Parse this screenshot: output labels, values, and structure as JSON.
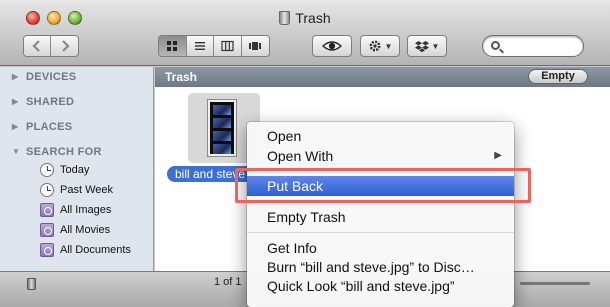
{
  "window": {
    "title": "Trash"
  },
  "toolbar": {
    "back_icon": "chevron-left-icon",
    "forward_icon": "chevron-right-icon",
    "view_modes": [
      "icon-view",
      "list-view",
      "column-view",
      "coverflow-view"
    ],
    "active_view": "icon-view",
    "quicklook_icon": "eye-icon",
    "action_icon": "gear-icon",
    "dropbox_icon": "dropbox-icon",
    "search_placeholder": ""
  },
  "sidebar": {
    "sections": [
      {
        "label": "DEVICES",
        "expanded": false
      },
      {
        "label": "SHARED",
        "expanded": false
      },
      {
        "label": "PLACES",
        "expanded": false
      },
      {
        "label": "SEARCH FOR",
        "expanded": true
      }
    ],
    "search_items": [
      {
        "label": "Today",
        "icon": "clock-icon"
      },
      {
        "label": "Past Week",
        "icon": "clock-icon"
      },
      {
        "label": "All Images",
        "icon": "smart-folder-icon"
      },
      {
        "label": "All Movies",
        "icon": "smart-folder-icon"
      },
      {
        "label": "All Documents",
        "icon": "smart-folder-icon"
      }
    ]
  },
  "content": {
    "path_title": "Trash",
    "empty_button": "Empty",
    "file": {
      "label": "bill and steve",
      "selected": true
    }
  },
  "status": {
    "text": "1 of 1"
  },
  "context_menu": {
    "items": [
      {
        "label": "Open",
        "group": 1
      },
      {
        "label": "Open With",
        "group": 1,
        "submenu": true
      },
      {
        "label": "Put Back",
        "group": 2,
        "highlighted": true
      },
      {
        "label": "Empty Trash",
        "group": 3
      },
      {
        "label": "Get Info",
        "group": 4
      },
      {
        "label": "Burn “bill and steve.jpg” to Disc…",
        "group": 4
      },
      {
        "label": "Quick Look “bill and steve.jpg”",
        "group": 4
      }
    ]
  },
  "colors": {
    "highlight": "#2f5fd6",
    "selection": "#3d6fd0",
    "annotation_box": "#e8665b",
    "sidebar_bg": "#dfe5ec"
  }
}
